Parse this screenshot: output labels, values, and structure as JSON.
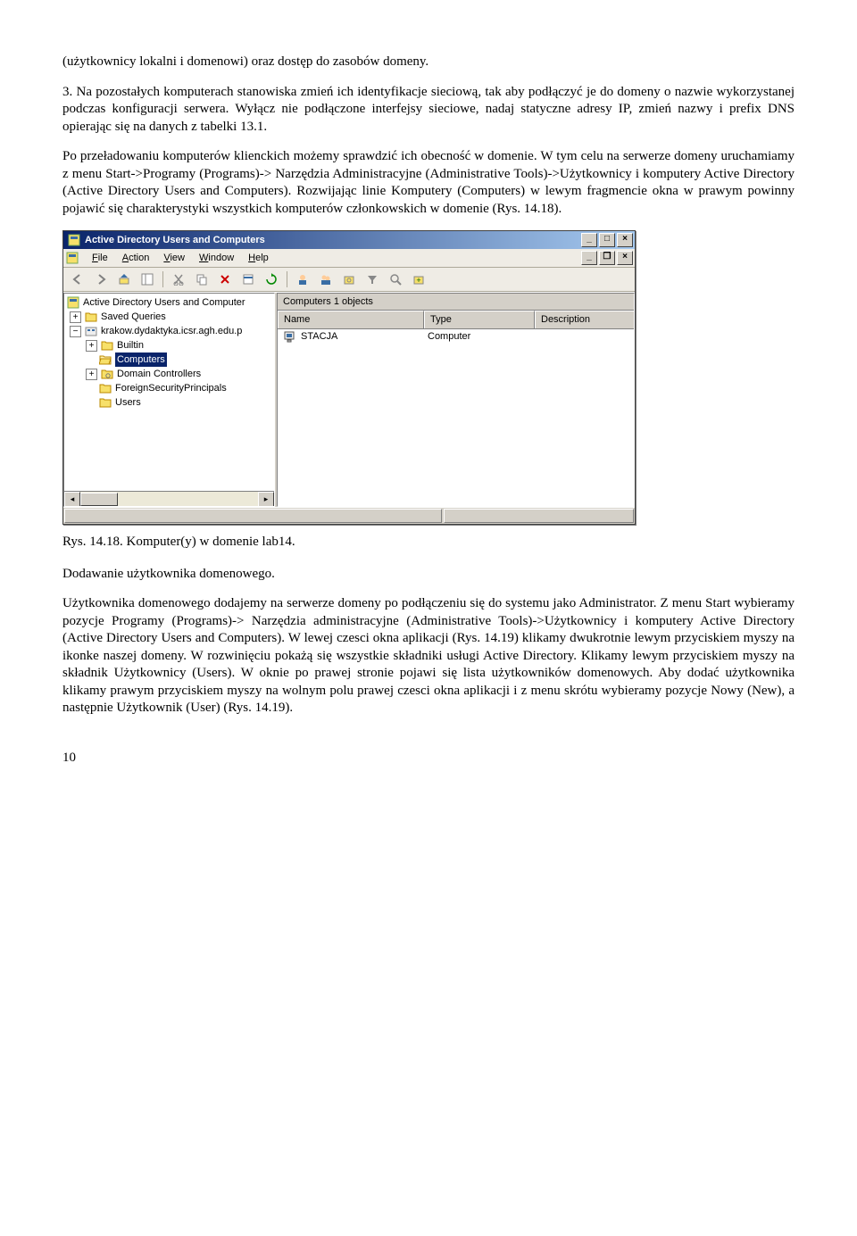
{
  "doc": {
    "p0": "(użytkownicy lokalni i domenowi) oraz dostęp do zasobów domeny.",
    "p1": "3. Na pozostałych komputerach stanowiska zmień ich identyfikacje sieciową, tak aby podłączyć je do domeny o nazwie wykorzystanej podczas konfiguracji serwera. Wyłącz nie podłączone interfejsy sieciowe, nadaj statyczne adresy IP, zmień nazwy i prefix DNS opierając się na danych z tabelki 13.1.",
    "p2": "Po przeładowaniu komputerów klienckich możemy sprawdzić ich obecność w domenie. W tym celu na serwerze domeny uruchamiamy z menu Start->Programy (Programs)-> Narzędzia Administracyjne (Administrative Tools)->Użytkownicy i komputery Active Directory (Active Directory Users and Computers). Rozwijając linie Komputery (Computers) w lewym fragmencie okna w prawym powinny pojawić się charakterystyki wszystkich komputerów członkowskich w domenie (Rys. 14.18).",
    "caption1": "Rys. 14.18. Komputer(y) w domenie lab14.",
    "p3": "Dodawanie użytkownika domenowego.",
    "p4": "Użytkownika domenowego dodajemy na serwerze domeny po podłączeniu się do systemu jako Administrator. Z menu Start wybieramy pozycje Programy (Programs)-> Narzędzia administracyjne (Administrative Tools)->Użytkownicy i komputery Active Directory (Active Directory Users and Computers). W lewej czesci okna aplikacji (Rys. 14.19) klikamy dwukrotnie lewym przyciskiem myszy na ikonke naszej domeny. W rozwinięciu pokażą się wszystkie składniki usługi Active Directory. Klikamy lewym przyciskiem myszy na składnik Użytkownicy (Users). W oknie po prawej stronie pojawi się lista użytkowników domenowych. Aby dodać użytkownika klikamy prawym przyciskiem myszy na wolnym polu prawej czesci okna aplikacji i z menu skrótu wybieramy pozycje Nowy (New), a następnie Użytkownik (User) (Rys. 14.19).",
    "pagenum": "10"
  },
  "win": {
    "title": "Active Directory Users and Computers",
    "menus": {
      "file": "File",
      "action": "Action",
      "view": "View",
      "window": "Window",
      "help": "Help"
    },
    "tree": {
      "root": "Active Directory Users and Computer",
      "saved": "Saved Queries",
      "domain": "krakow.dydaktyka.icsr.agh.edu.p",
      "builtin": "Builtin",
      "computers": "Computers",
      "dc": "Domain Controllers",
      "fsp": "ForeignSecurityPrincipals",
      "users": "Users"
    },
    "list": {
      "info": "Computers   1 objects",
      "col1": "Name",
      "col2": "Type",
      "col3": "Description",
      "row1_name": "STACJA",
      "row1_type": "Computer"
    }
  }
}
